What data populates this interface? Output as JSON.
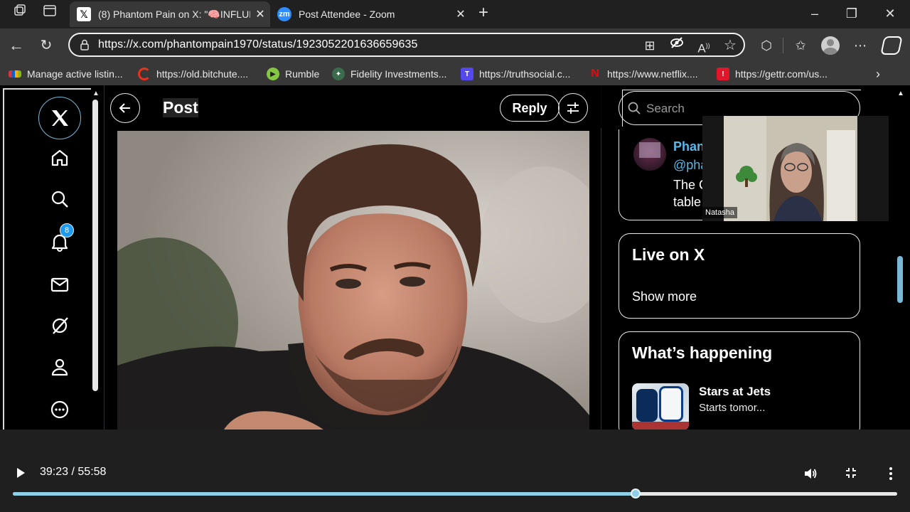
{
  "browser": {
    "tabs": [
      {
        "title": "(8) Phantom Pain on X: \"🧠INFLUE",
        "favicon": "x-logo",
        "active": true
      },
      {
        "title": "Post Attendee - Zoom",
        "favicon": "zoom-logo",
        "active": false
      }
    ],
    "url": "https://x.com/phantompain1970/status/1923052201636659635",
    "bookmarks": [
      {
        "label": "Manage active listin...",
        "icon": "multicolor-bar-icon"
      },
      {
        "label": "https://old.bitchute....",
        "icon": "bitchute-icon"
      },
      {
        "label": "Rumble",
        "icon": "rumble-icon"
      },
      {
        "label": "Fidelity Investments...",
        "icon": "fidelity-icon"
      },
      {
        "label": "https://truthsocial.c...",
        "icon": "truthsocial-icon"
      },
      {
        "label": "https://www.netflix....",
        "icon": "netflix-icon"
      },
      {
        "label": "https://gettr.com/us...",
        "icon": "gettr-icon"
      }
    ]
  },
  "x": {
    "nav": {
      "notification_count": "8",
      "items": [
        "x-logo-icon",
        "home-icon",
        "explore-icon",
        "notifications-icon",
        "messages-icon",
        "grok-icon",
        "profile-icon",
        "more-icon"
      ]
    },
    "header": {
      "title": "Post",
      "reply_label": "Reply"
    },
    "search": {
      "placeholder": "Search"
    },
    "profile_card": {
      "name": "Phan",
      "handle": "@pha",
      "text_line1": "The C",
      "text_line2": "table"
    },
    "live_card": {
      "title": "Live on X",
      "show_more": "Show more"
    },
    "happening": {
      "title": "What’s happening",
      "item_title": "Stars at Jets",
      "item_sub": "Starts tomor..."
    }
  },
  "zoom": {
    "participant_name": "Natasha"
  },
  "player": {
    "current_time": "39:23",
    "separator": "/",
    "duration": "55:58",
    "progress": 0.704
  },
  "colors": {
    "progress_fill": "#8fd0e8",
    "link_blue": "#1d9bf0"
  }
}
